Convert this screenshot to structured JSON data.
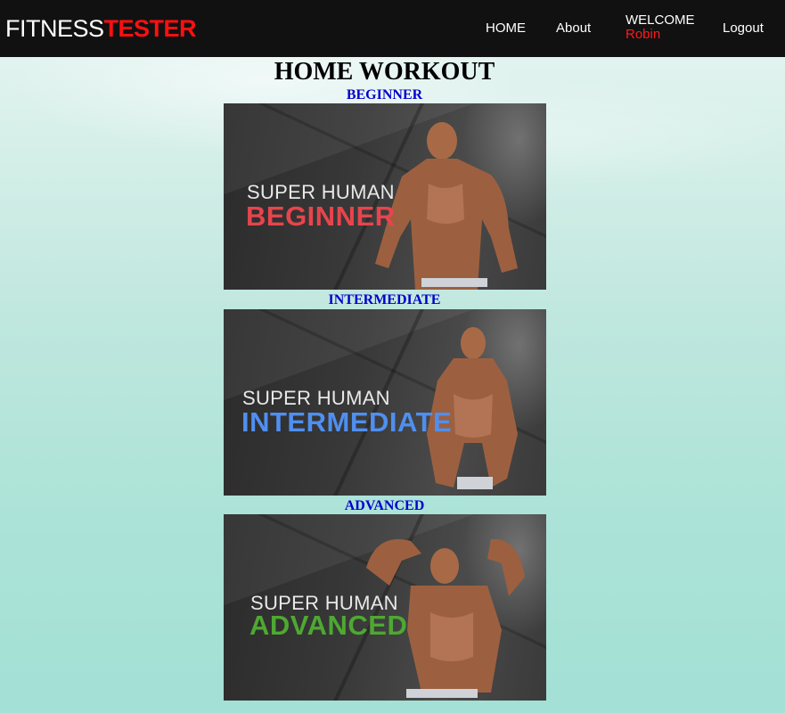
{
  "navbar": {
    "brand_part1": "FITNESS",
    "brand_part2": "TESTER",
    "home": "HOME",
    "about": "About",
    "welcome": "WELCOME",
    "username": "Robin",
    "logout": "Logout"
  },
  "main": {
    "title": "HOME WORKOUT",
    "levels": [
      {
        "label": "BEGINNER",
        "card_line1": "SUPER HUMAN",
        "card_line2": "BEGINNER",
        "accent": "#e8444c"
      },
      {
        "label": "INTERMEDIATE",
        "card_line1": "SUPER HUMAN",
        "card_line2": "INTERMEDIATE",
        "accent": "#4f8ff0"
      },
      {
        "label": "ADVANCED",
        "card_line1": "SUPER HUMAN",
        "card_line2": "ADVANCED",
        "accent": "#4ea832"
      }
    ]
  },
  "colors": {
    "navbar_bg": "#111111",
    "brand_accent": "#ff1010",
    "link_blue": "#0000cc",
    "skin": "#a86a46"
  }
}
